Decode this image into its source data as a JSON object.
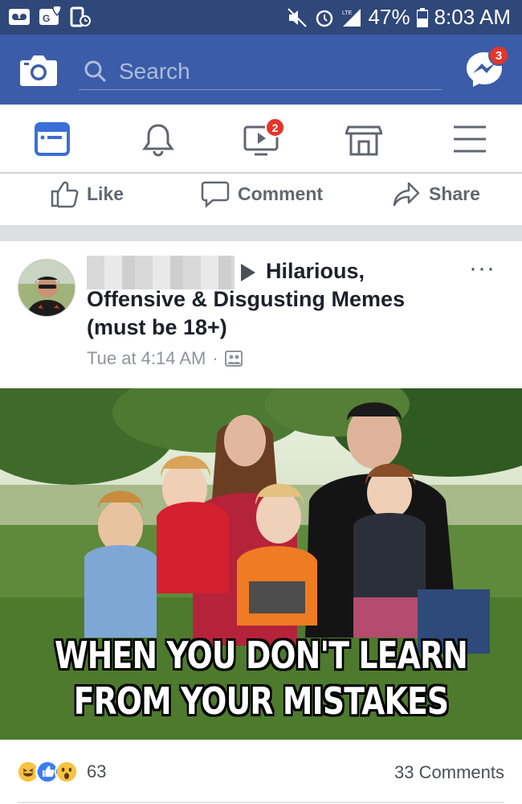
{
  "status_bar": {
    "battery": "47%",
    "time": "8:03 AM",
    "network": "LTE"
  },
  "app_bar": {
    "search_placeholder": "Search",
    "messenger_badge": "3"
  },
  "tabs": [
    {
      "name": "news-feed",
      "icon": "feed-icon",
      "active": true
    },
    {
      "name": "notifications",
      "icon": "bell-icon"
    },
    {
      "name": "watch",
      "icon": "video-icon",
      "badge": "2"
    },
    {
      "name": "marketplace",
      "icon": "store-icon"
    },
    {
      "name": "menu",
      "icon": "hamburger-icon"
    }
  ],
  "action_row": {
    "like": "Like",
    "comment": "Comment",
    "share": "Share"
  },
  "post": {
    "group_line1": "Hilarious,",
    "group_line2": "Offensive & Disgusting Memes",
    "group_line3": "(must be 18+)",
    "timestamp": "Tue at 4:14 AM",
    "separator": "·",
    "privacy_icon": "group-icon",
    "more": "···",
    "meme_caption_line1": "WHEN YOU DON'T LEARN",
    "meme_caption_line2": "FROM YOUR MISTAKES",
    "reaction_count": "63",
    "comment_count": "33 Comments"
  },
  "colors": {
    "status_bar": "#2f4779",
    "app_bar": "#3b5ca8",
    "badge": "#e4352a",
    "feed_tab_active": "#3b6fd8"
  }
}
